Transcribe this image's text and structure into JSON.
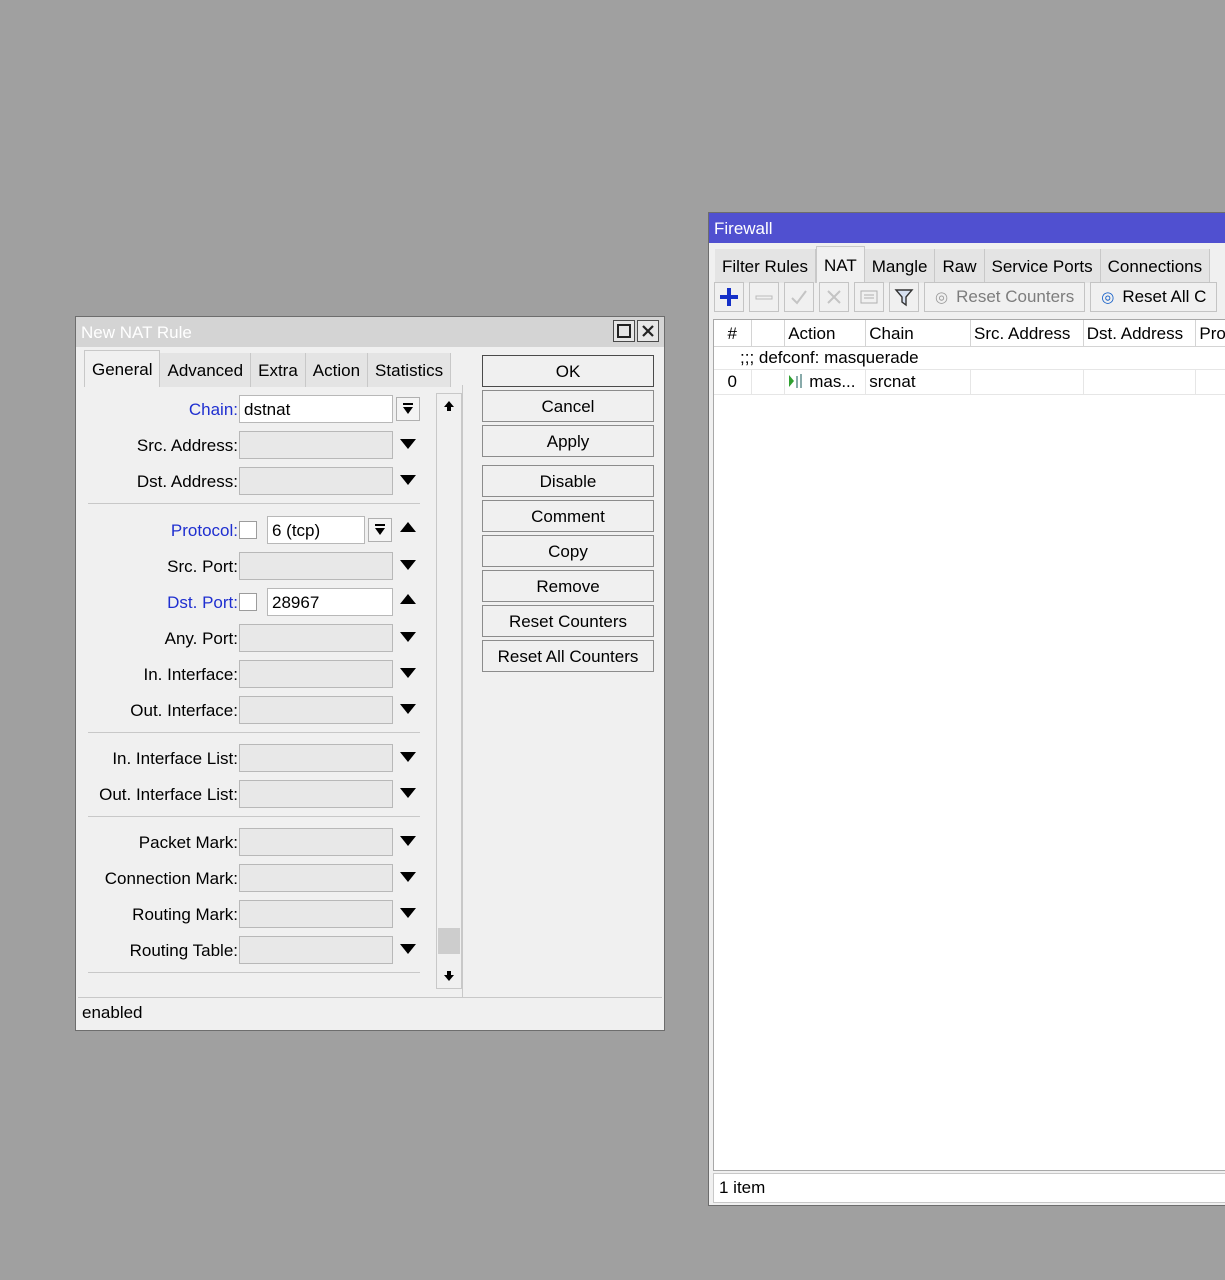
{
  "firewall": {
    "title": "Firewall",
    "tabs": [
      "Filter Rules",
      "NAT",
      "Mangle",
      "Raw",
      "Service Ports",
      "Connections"
    ],
    "active_tab": "NAT",
    "toolbar": {
      "reset_counters": "Reset Counters",
      "reset_all": "Reset All C",
      "icons": [
        "add-icon",
        "remove-icon",
        "enable-icon",
        "disable-icon",
        "comment-icon",
        "filter-icon"
      ]
    },
    "columns": [
      "#",
      "",
      "Action",
      "Chain",
      "Src. Address",
      "Dst. Address",
      "Pro"
    ],
    "comment": ";;; defconf: masquerade",
    "rows": [
      {
        "num": "0",
        "action": "mas...",
        "chain": "srcnat",
        "src": "",
        "dst": "",
        "proto": ""
      }
    ],
    "status": "1 item",
    "colors": {
      "titlebar": "#5050d0"
    }
  },
  "nat": {
    "title": "New NAT Rule",
    "tabs": [
      "General",
      "Advanced",
      "Extra",
      "Action",
      "Statistics"
    ],
    "active_tab": "General",
    "fields": {
      "chain": {
        "label": "Chain:",
        "value": "dstnat"
      },
      "src_address": {
        "label": "Src. Address:",
        "value": ""
      },
      "dst_address": {
        "label": "Dst. Address:",
        "value": ""
      },
      "protocol": {
        "label": "Protocol:",
        "value": "6 (tcp)"
      },
      "src_port": {
        "label": "Src. Port:",
        "value": ""
      },
      "dst_port": {
        "label": "Dst. Port:",
        "value": "28967"
      },
      "any_port": {
        "label": "Any. Port:",
        "value": ""
      },
      "in_interface": {
        "label": "In. Interface:",
        "value": ""
      },
      "out_interface": {
        "label": "Out. Interface:",
        "value": ""
      },
      "in_interface_list": {
        "label": "In. Interface List:",
        "value": ""
      },
      "out_interface_list": {
        "label": "Out. Interface List:",
        "value": ""
      },
      "packet_mark": {
        "label": "Packet Mark:",
        "value": ""
      },
      "connection_mark": {
        "label": "Connection Mark:",
        "value": ""
      },
      "routing_mark": {
        "label": "Routing Mark:",
        "value": ""
      },
      "routing_table": {
        "label": "Routing Table:",
        "value": ""
      }
    },
    "buttons": {
      "ok": "OK",
      "cancel": "Cancel",
      "apply": "Apply",
      "disable": "Disable",
      "comment": "Comment",
      "copy": "Copy",
      "remove": "Remove",
      "reset_counters": "Reset Counters",
      "reset_all_counters": "Reset All Counters"
    },
    "status": "enabled"
  }
}
